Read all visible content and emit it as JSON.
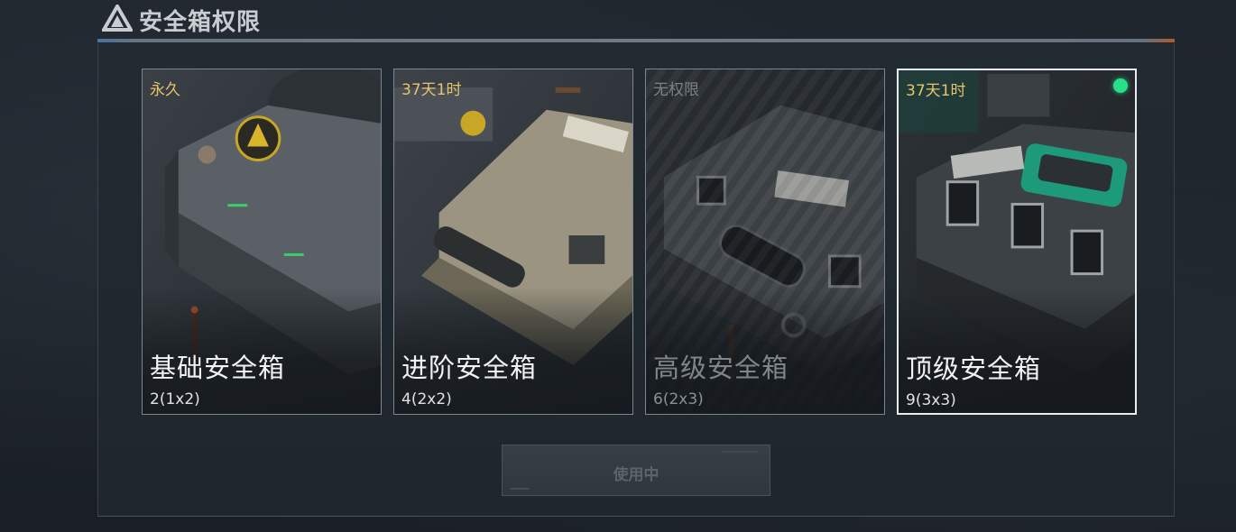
{
  "header": {
    "title": "安全箱权限",
    "icon": "delta-logo-icon"
  },
  "cards": [
    {
      "status": "永久",
      "name": "基础安全箱",
      "size": "2(1x2)",
      "locked": false,
      "selected": false
    },
    {
      "status": "37天1时",
      "name": "进阶安全箱",
      "size": "4(2x2)",
      "locked": false,
      "selected": false
    },
    {
      "status": "无权限",
      "name": "高级安全箱",
      "size": "6(2x3)",
      "locked": true,
      "selected": false
    },
    {
      "status": "37天1时",
      "name": "顶级安全箱",
      "size": "9(3x3)",
      "locked": false,
      "selected": true
    }
  ],
  "action": {
    "label": "使用中",
    "enabled": false
  },
  "colors": {
    "status_gold": "#e7c46a",
    "selected_dot": "#29e08a",
    "locked_text": "#7c8288"
  }
}
